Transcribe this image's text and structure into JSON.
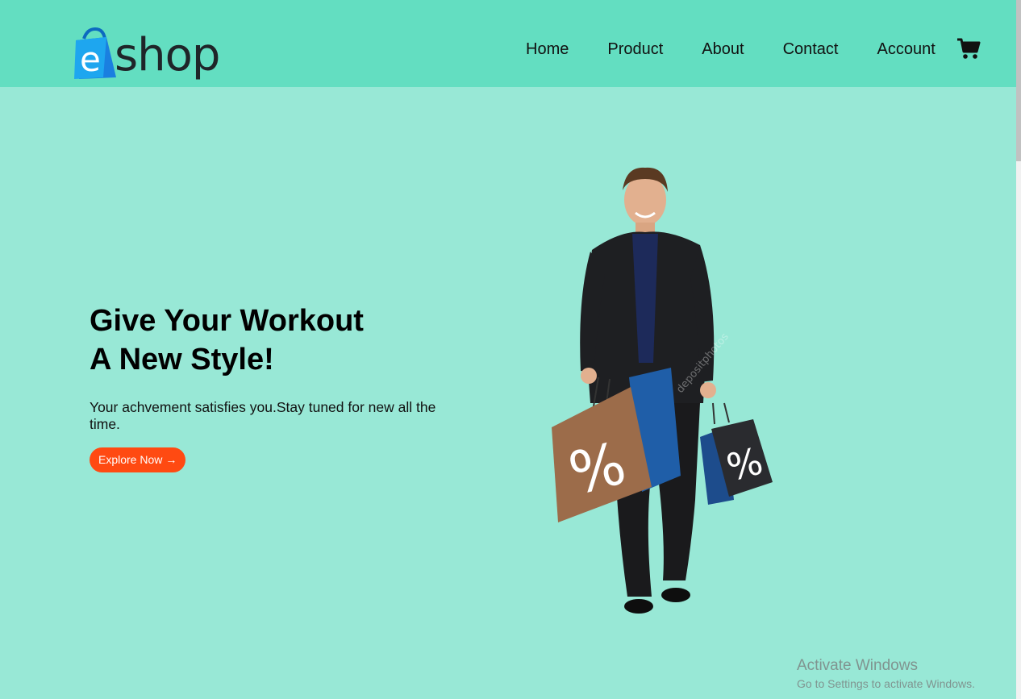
{
  "brand": {
    "logo_letter": "e",
    "logo_text": "shop"
  },
  "nav": {
    "items": [
      {
        "label": "Home"
      },
      {
        "label": "Product"
      },
      {
        "label": "About"
      },
      {
        "label": "Contact"
      },
      {
        "label": "Account"
      }
    ],
    "cart_icon": "shopping-cart-icon"
  },
  "hero": {
    "title_line1": "Give Your Workout",
    "title_line2": "A New Style!",
    "subtitle": "Your achvement satisfies you.Stay tuned for new all the time.",
    "cta_label": "Explore Now",
    "cta_icon": "arrow-right-icon",
    "bag_labels": [
      "%",
      "%"
    ],
    "image_watermark": "depositphotos"
  },
  "watermark": {
    "title": "Activate Windows",
    "subtitle": "Go to Settings to activate Windows."
  },
  "colors": {
    "header_bg": "#63dec1",
    "page_bg": "#98e8d6",
    "cta_bg": "#ff4a12",
    "logo_blue": "#1aa3e8"
  }
}
